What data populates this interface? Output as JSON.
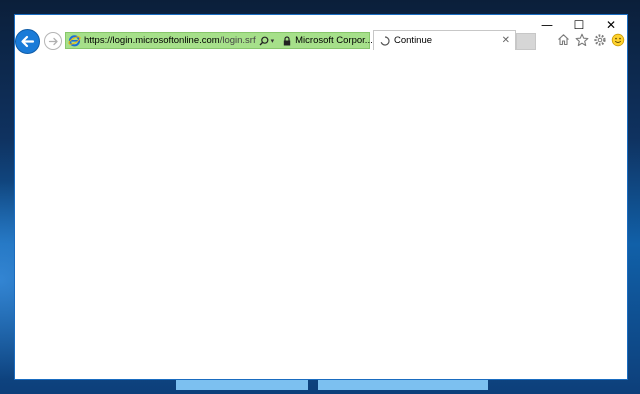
{
  "window": {
    "caption_buttons": [
      {
        "name": "minimize-button",
        "icon": "minimize-icon",
        "glyph": "—"
      },
      {
        "name": "maximize-button",
        "icon": "maximize-icon",
        "glyph": "☐"
      },
      {
        "name": "close-button",
        "icon": "close-icon",
        "glyph": "✕"
      }
    ]
  },
  "address_bar": {
    "url_host": "https://login.microsoftonline.com",
    "url_path": "/login.srf",
    "certificate": "Microsoft Corpor...",
    "close_glyph": "✕",
    "dropdown_glyph": "▾",
    "color": "#a6e08a"
  },
  "tab": {
    "title": "Continue",
    "close_glyph": "✕"
  },
  "toolbar": {
    "icons": [
      "home-icon",
      "favorites-star-icon",
      "settings-gear-icon",
      "feedback-smiley-icon"
    ]
  },
  "colors": {
    "back_button": "#1a7bd8",
    "window_border": "#1a6cc0"
  }
}
